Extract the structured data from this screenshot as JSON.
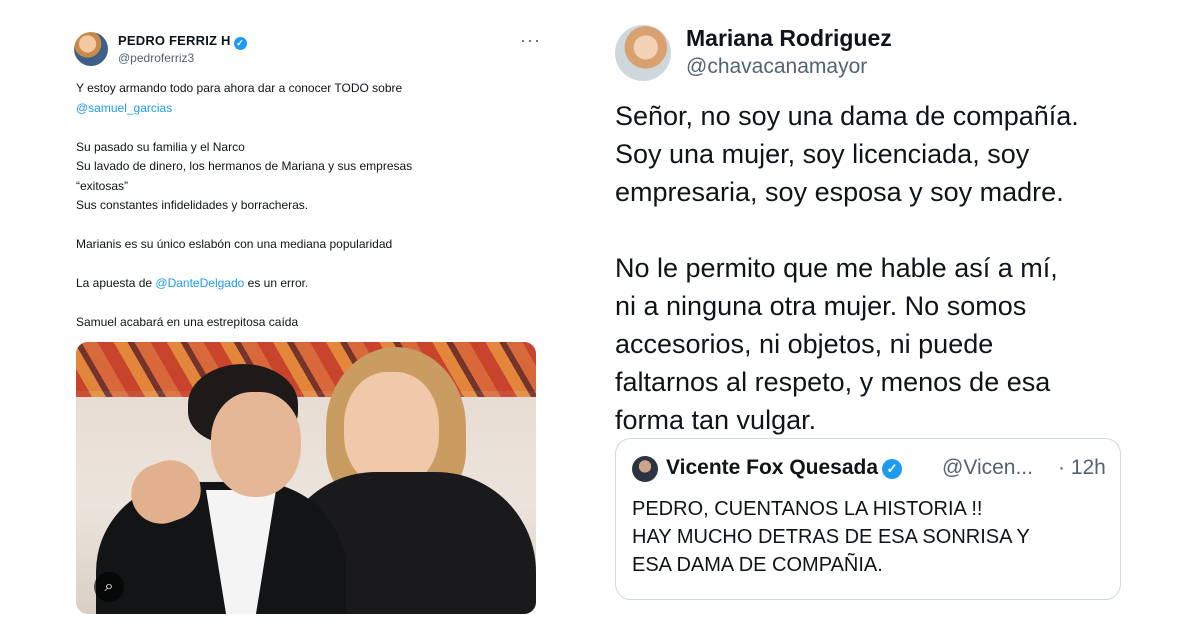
{
  "left_tweet": {
    "author_name": "PEDRO FERRIZ H",
    "verified_glyph": "✓",
    "handle": "@pedroferriz3",
    "more_glyph": "···",
    "lines": {
      "l1": "Y estoy armando todo para ahora dar a conocer TODO sobre",
      "l2": "@samuel_garcias",
      "l3": "Su pasado su familia y  el Narco",
      "l4": "Su lavado de dinero, los hermanos de Mariana y sus empresas",
      "l5": "“exitosas”",
      "l6": "Sus constantes infidelidades y borracheras.",
      "l7": "Marianis es su único eslabón con una mediana popularidad",
      "l8_pre": "La apuesta de ",
      "l8_mention": "@DanteDelgado",
      "l8_post": " es un error.",
      "l9": "Samuel acabará en una estrepitosa caída"
    },
    "lens_glyph": "⌕"
  },
  "right_tweet": {
    "author_name": "Mariana Rodriguez",
    "handle": "@chavacanamayor",
    "lines": {
      "p1a": "Señor, no soy una dama de compañía.",
      "p1b": "Soy una mujer, soy licenciada, soy",
      "p1c": "empresaria, soy esposa y soy madre.",
      "p2a": "No le permito que me hable así a mí,",
      "p2b": "ni a ninguna otra mujer. No somos",
      "p2c": "accesorios, ni objetos, ni puede",
      "p2d": "faltarnos al respeto, y menos de esa",
      "p2e": "forma tan vulgar."
    },
    "quote": {
      "author_name": "Vicente Fox Quesada",
      "verified_glyph": "✓",
      "handle": "@Vicen...",
      "time": "· 12h",
      "lines": {
        "q1": "PEDRO, CUENTANOS LA HISTORIA !!",
        "q2": "HAY MUCHO DETRAS DE ESA SONRISA Y",
        "q3": "ESA DAMA DE COMPAÑIA."
      }
    }
  }
}
